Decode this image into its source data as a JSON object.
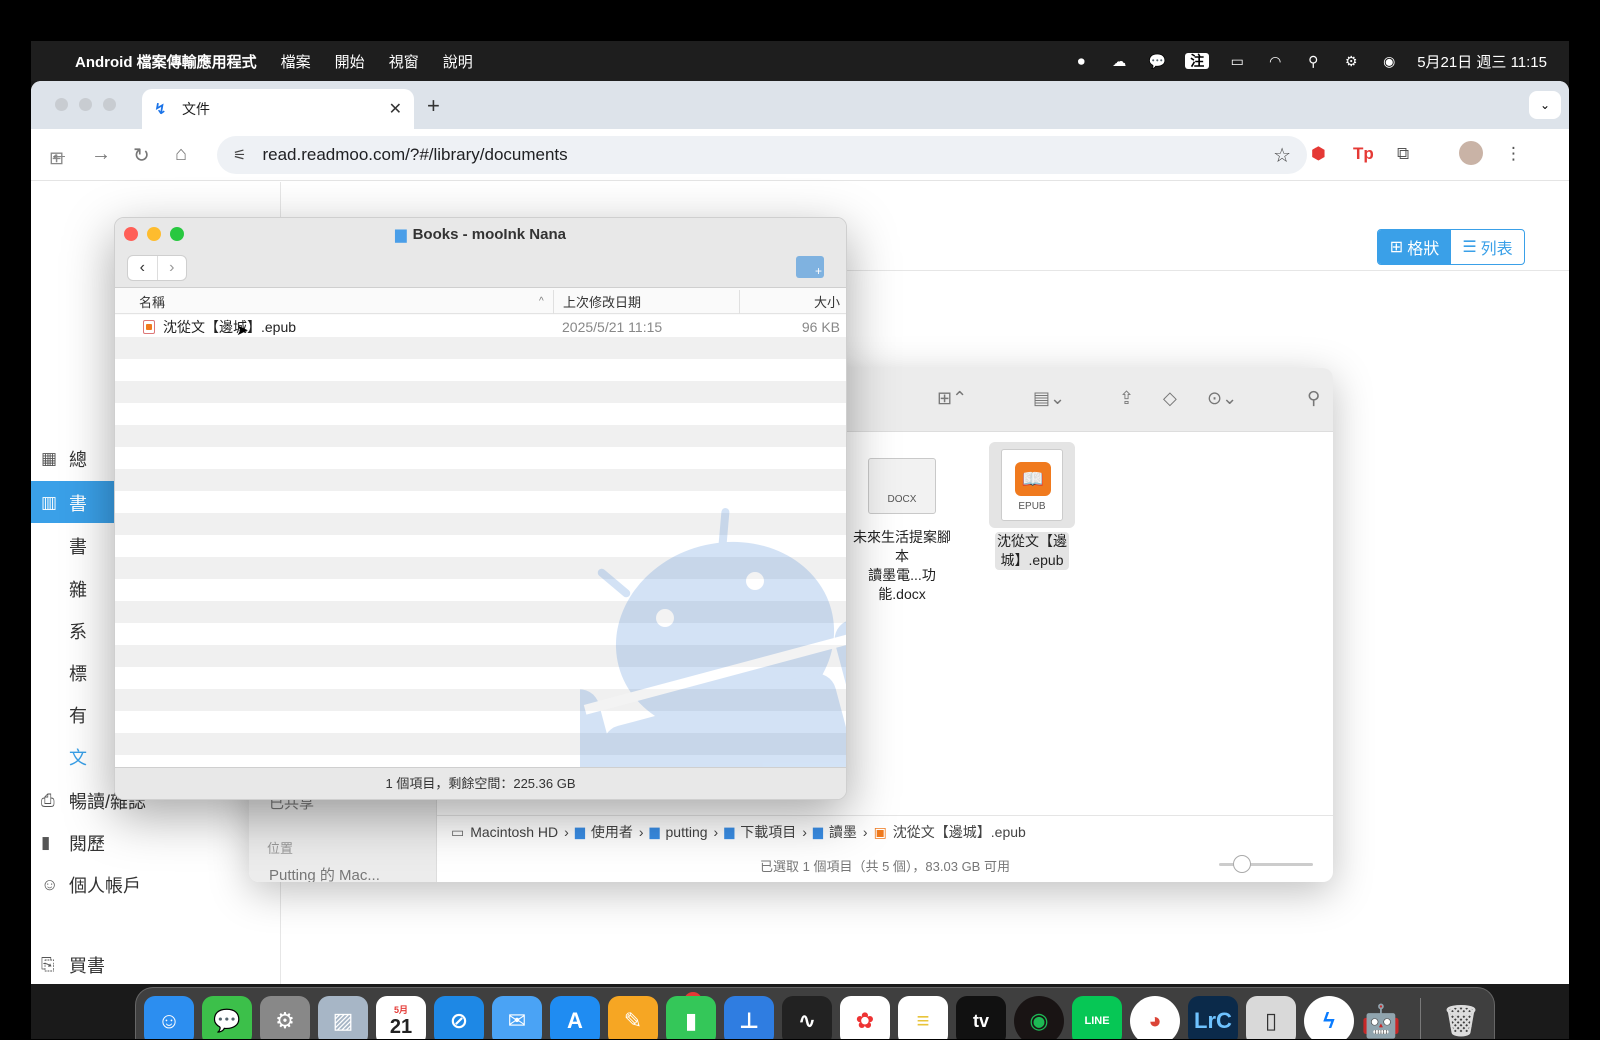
{
  "menubar": {
    "app_name": "Android 檔案傳輸應用程式",
    "menus": [
      "檔案",
      "開始",
      "視窗",
      "說明"
    ],
    "ime": "注",
    "clock": "5月21日 週三 11:15"
  },
  "browser": {
    "tab_title": "文件",
    "url": "read.readmoo.com/?#/library/documents"
  },
  "page": {
    "sidebar_items": [
      "總",
      "書",
      "暢讀/雜誌",
      "閱歷",
      "個人帳戶",
      "買書"
    ],
    "sidebar_subitems": [
      "書",
      "雜",
      "系",
      "標",
      "有",
      "文"
    ],
    "view_grid": "格狀",
    "view_list": "列表"
  },
  "finder": {
    "sidebar_shared": "已共享",
    "sidebar_location_label": "位置",
    "sidebar_location_item": "Putting 的 Mac...",
    "files": [
      {
        "name_line1": "未來生活提案腳本",
        "name_line2": "讀墨電...功能.docx",
        "type_label": "DOCX"
      },
      {
        "name_line1": "沈從文【邊",
        "name_line2": "城】.epub",
        "type_label": "EPUB"
      }
    ],
    "path": [
      "Macintosh HD",
      "使用者",
      "putting",
      "下載項目",
      "讀墨",
      "沈從文【邊城】.epub"
    ],
    "status": "已選取 1 個項目（共 5 個），83.03 GB 可用"
  },
  "aft": {
    "title": "Books - mooInk Nana",
    "col_name": "名稱",
    "col_date": "上次修改日期",
    "col_size": "大小",
    "file": {
      "name": "沈從文【邊城】.epub",
      "date": "2025/5/21 11:15",
      "size": "96 KB"
    },
    "footer": "1 個項目，剩餘空間：225.36 GB"
  },
  "dock": {
    "calendar_month": "5月",
    "calendar_day": "21",
    "appstore_badge": "2",
    "tv_label": "tv",
    "lrc_label": "LrC",
    "line_label": "LINE"
  }
}
